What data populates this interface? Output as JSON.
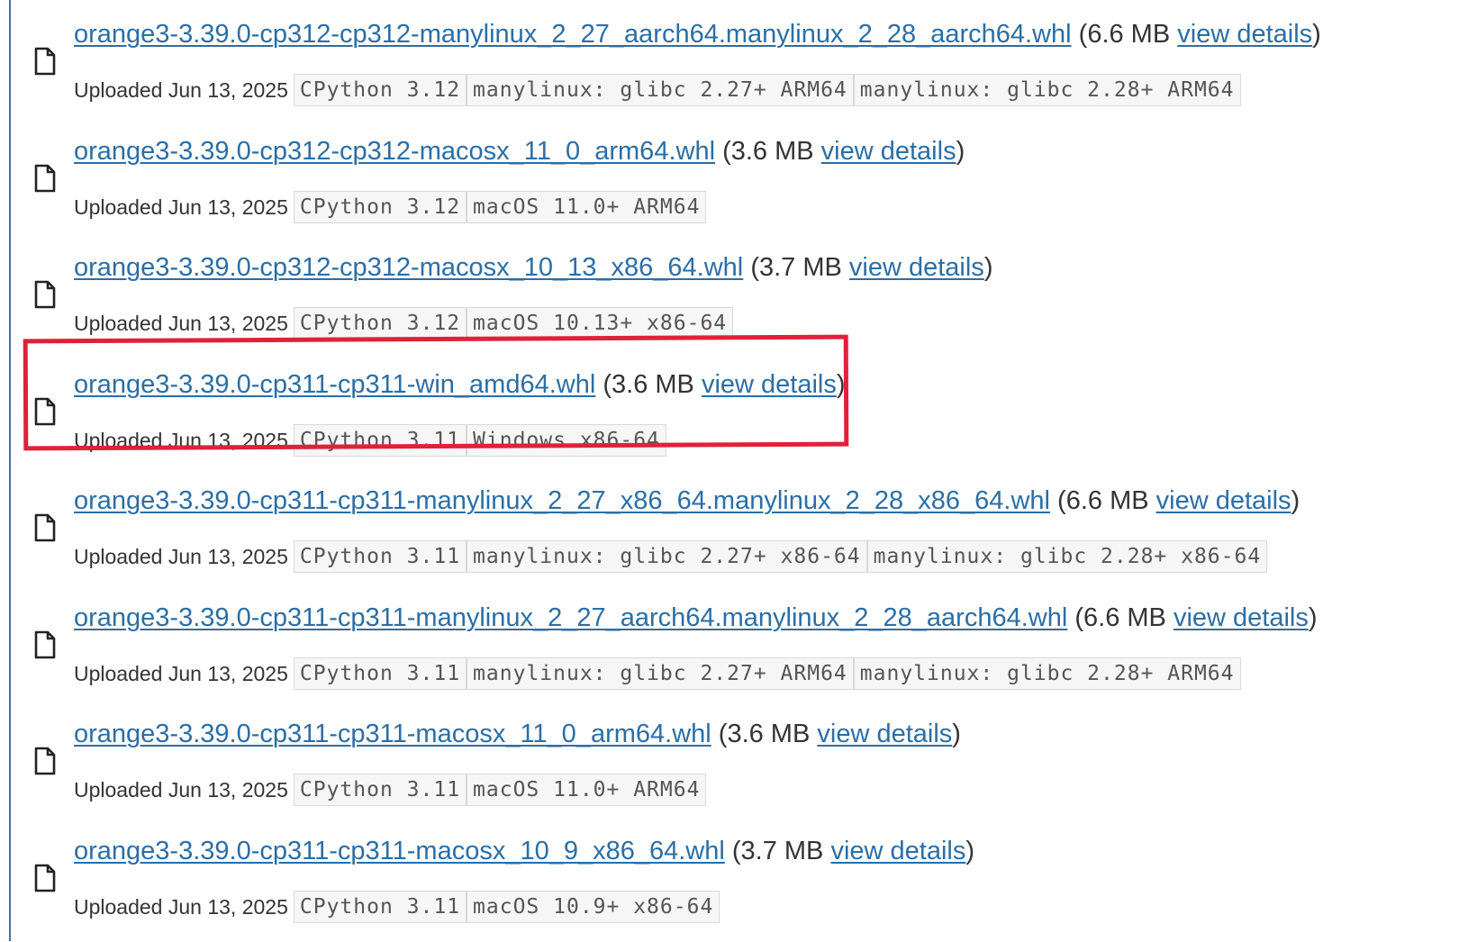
{
  "files": [
    {
      "filename": "orange3-3.39.0-cp312-cp312-manylinux_2_27_aarch64.manylinux_2_28_aarch64.whl",
      "size": "(6.6 MB",
      "details_label": "view details",
      "close_paren": ")",
      "uploaded": "Uploaded Jun 13, 2025",
      "tags": [
        "CPython 3.12",
        "manylinux: glibc 2.27+ ARM64",
        "manylinux: glibc 2.28+ ARM64"
      ]
    },
    {
      "filename": "orange3-3.39.0-cp312-cp312-macosx_11_0_arm64.whl",
      "size": "(3.6 MB",
      "details_label": "view details",
      "close_paren": ")",
      "uploaded": "Uploaded Jun 13, 2025",
      "tags": [
        "CPython 3.12",
        "macOS 11.0+ ARM64"
      ]
    },
    {
      "filename": "orange3-3.39.0-cp312-cp312-macosx_10_13_x86_64.whl",
      "size": "(3.7 MB",
      "details_label": "view details",
      "close_paren": ")",
      "uploaded": "Uploaded Jun 13, 2025",
      "tags": [
        "CPython 3.12",
        "macOS 10.13+ x86-64"
      ]
    },
    {
      "filename": "orange3-3.39.0-cp311-cp311-win_amd64.whl",
      "size": "(3.6 MB",
      "details_label": "view details",
      "close_paren": ")",
      "uploaded": "Uploaded Jun 13, 2025",
      "tags": [
        "CPython 3.11",
        "Windows x86-64"
      ]
    },
    {
      "filename": "orange3-3.39.0-cp311-cp311-manylinux_2_27_x86_64.manylinux_2_28_x86_64.whl",
      "size": "(6.6 MB",
      "details_label": "view details",
      "close_paren": ")",
      "uploaded": "Uploaded Jun 13, 2025",
      "tags": [
        "CPython 3.11",
        "manylinux: glibc 2.27+ x86-64",
        "manylinux: glibc 2.28+ x86-64"
      ]
    },
    {
      "filename": "orange3-3.39.0-cp311-cp311-manylinux_2_27_aarch64.manylinux_2_28_aarch64.whl",
      "size": "(6.6 MB",
      "details_label": "view details",
      "close_paren": ")",
      "uploaded": "Uploaded Jun 13, 2025",
      "tags": [
        "CPython 3.11",
        "manylinux: glibc 2.27+ ARM64",
        "manylinux: glibc 2.28+ ARM64"
      ]
    },
    {
      "filename": "orange3-3.39.0-cp311-cp311-macosx_11_0_arm64.whl",
      "size": "(3.6 MB",
      "details_label": "view details",
      "close_paren": ")",
      "uploaded": "Uploaded Jun 13, 2025",
      "tags": [
        "CPython 3.11",
        "macOS 11.0+ ARM64"
      ]
    },
    {
      "filename": "orange3-3.39.0-cp311-cp311-macosx_10_9_x86_64.whl",
      "size": "(3.7 MB",
      "details_label": "view details",
      "close_paren": ")",
      "uploaded": "Uploaded Jun 13, 2025",
      "tags": [
        "CPython 3.11",
        "macOS 10.9+ x86-64"
      ]
    }
  ],
  "highlight": {
    "color": "#e0213a",
    "target_index": 3
  },
  "colors": {
    "link": "#2b6ea6",
    "text": "#333333",
    "tag_bg": "#f6f6f6",
    "tag_border": "#d9d9d9"
  },
  "icons": {
    "file": "file-icon"
  }
}
